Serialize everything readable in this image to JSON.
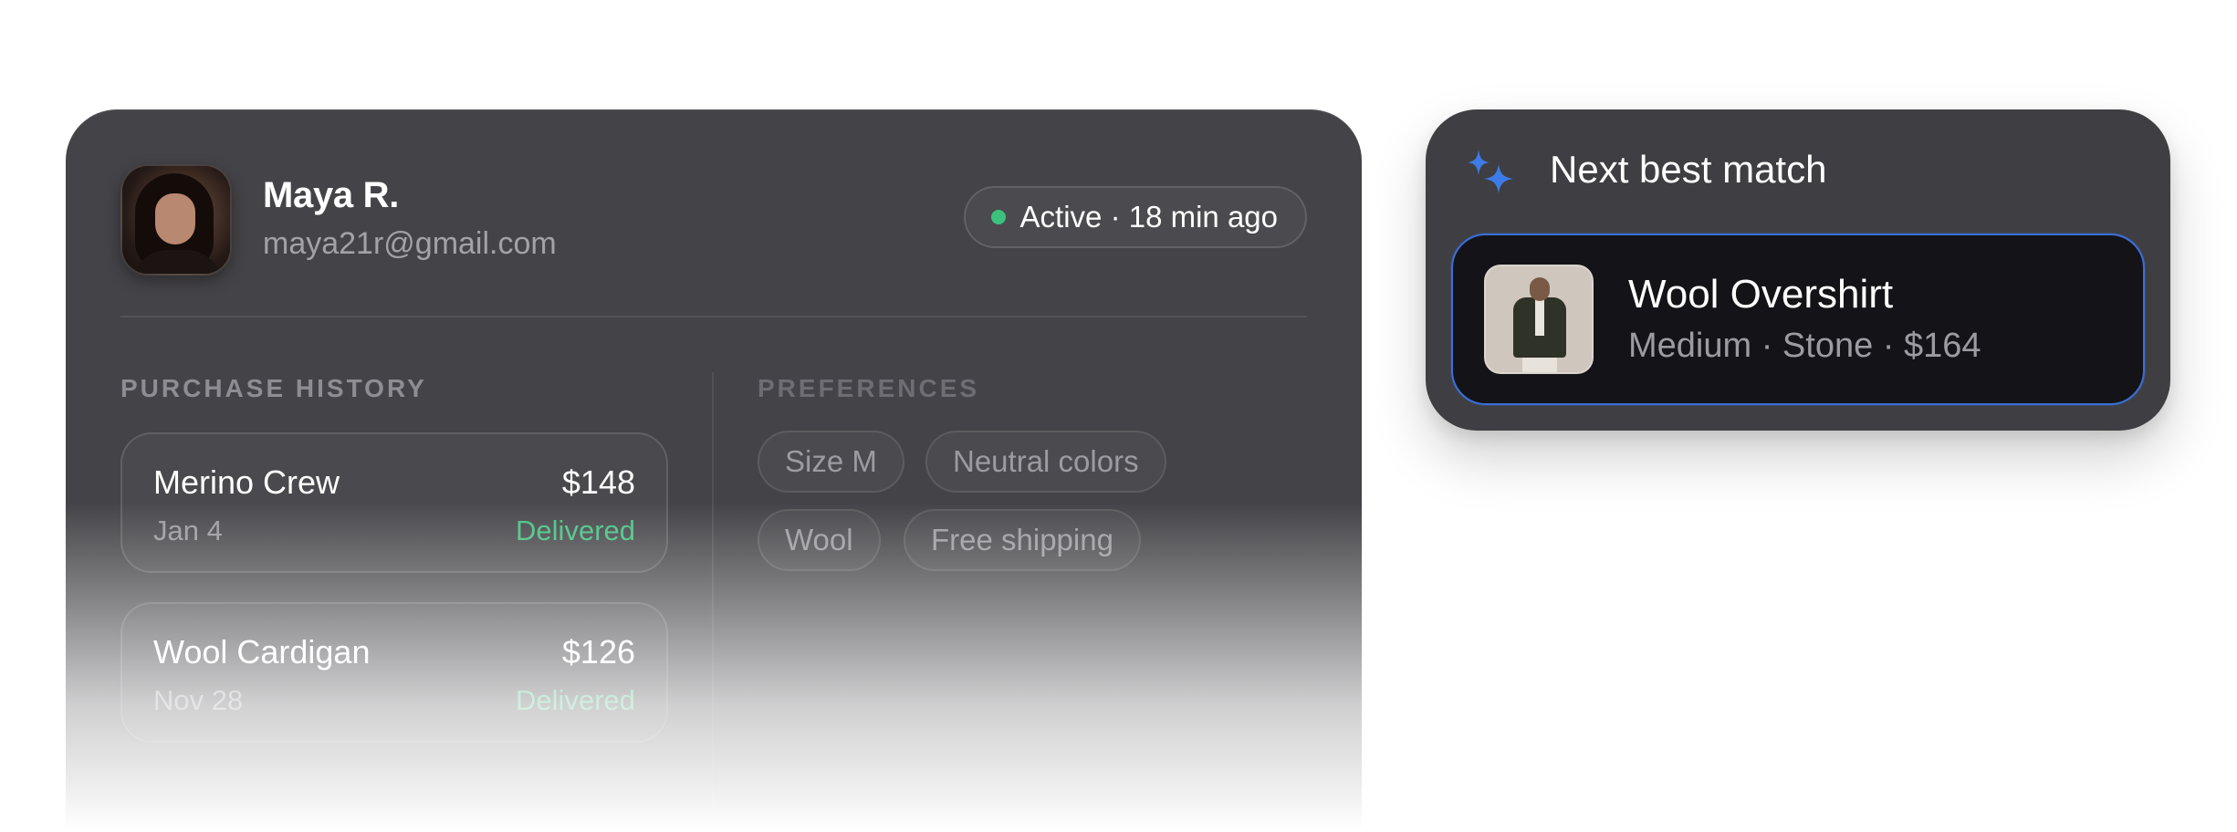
{
  "customer": {
    "name": "Maya R.",
    "email": "maya21r@gmail.com",
    "status": "Active · 18 min ago"
  },
  "purchase_history": {
    "label": "PURCHASE HISTORY",
    "orders": [
      {
        "name": "Merino Crew",
        "price": "$148",
        "date": "Jan 4",
        "status": "Delivered"
      },
      {
        "name": "Wool Cardigan",
        "price": "$126",
        "date": "Nov 28",
        "status": "Delivered"
      }
    ]
  },
  "preferences": {
    "label": "PREFERENCES",
    "chips": [
      "Size M",
      "Neutral colors",
      "Wool",
      "Free shipping"
    ]
  },
  "next_best_match": {
    "title": "Next best match",
    "icon": "sparkle-icon",
    "product": {
      "name": "Wool Overshirt",
      "meta": "Medium · Stone · $164"
    }
  },
  "colors": {
    "status_active": "#3cc27c",
    "delivered": "#48c283",
    "accent_blue": "#3a6fd6"
  }
}
